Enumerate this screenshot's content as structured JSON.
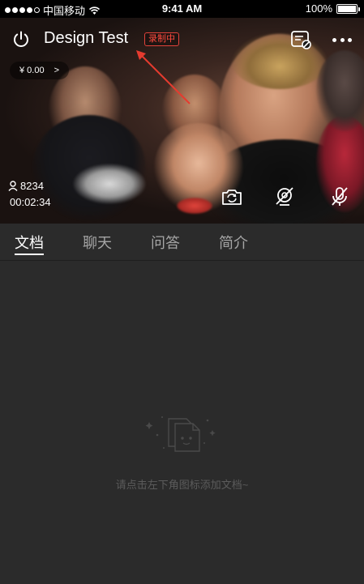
{
  "status_bar": {
    "carrier": "中国移动",
    "time": "9:41 AM",
    "battery": "100%"
  },
  "header": {
    "title": "Design Test",
    "recording_badge": "录制中",
    "reward_amount": "¥ 0.00",
    "reward_chevron": ">"
  },
  "stream": {
    "viewer_count": "8234",
    "duration": "00:02:34"
  },
  "controls": {
    "icons": [
      "power-icon",
      "settings-list-icon",
      "more-icon",
      "camera-switch-icon",
      "camera-off-icon",
      "mic-off-icon"
    ]
  },
  "tabs": [
    {
      "label": "文档",
      "active": true
    },
    {
      "label": "聊天",
      "active": false
    },
    {
      "label": "问答",
      "active": false
    },
    {
      "label": "简介",
      "active": false
    }
  ],
  "empty_state": {
    "message": "请点击左下角图标添加文档~"
  },
  "colors": {
    "recording_red": "#e0423a",
    "annotation_red": "#e53b2f",
    "panel_bg": "#2b2b2b",
    "muted_text": "#5b5b5b"
  }
}
